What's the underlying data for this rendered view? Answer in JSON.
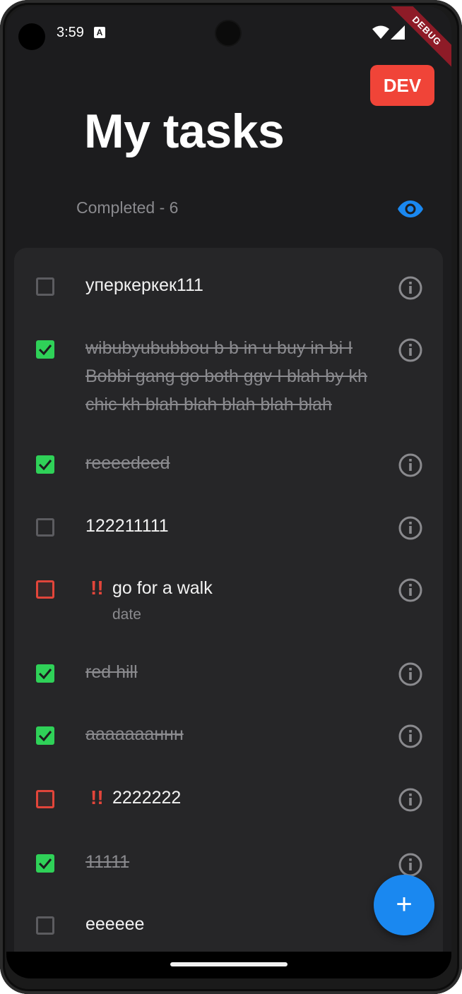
{
  "status_bar": {
    "time": "3:59",
    "notification_icon_letter": "A",
    "icons": [
      "wifi-icon",
      "signal-icon"
    ]
  },
  "debug_banner": "DEBUG",
  "env_badge": "DEV",
  "header": {
    "title": "My tasks",
    "completed_label": "Completed - 6",
    "visibility_icon": "eye-icon"
  },
  "colors": {
    "accent": "#1a88f0",
    "check": "#2fd158",
    "priority": "#e2453a",
    "badge": "#f04438"
  },
  "tasks": [
    {
      "text": "уперкеркек111",
      "done": false,
      "priority": false
    },
    {
      "text": "wibubyububbou b b in u buy in bi I Bobbi gang go both ggv I blah by kh chic kh blah blah blah blah blah",
      "done": true,
      "priority": false
    },
    {
      "text": "reeeedeed",
      "done": true,
      "priority": false
    },
    {
      "text": "122211111",
      "done": false,
      "priority": false
    },
    {
      "text": "go for a walk",
      "done": false,
      "priority": true,
      "priority_mark": "!!",
      "subtitle": "date"
    },
    {
      "text": "red hill",
      "done": true,
      "priority": false
    },
    {
      "text": "аааааааннн",
      "done": true,
      "priority": false
    },
    {
      "text": "2222222",
      "done": false,
      "priority": true,
      "priority_mark": "!!"
    },
    {
      "text": "11111",
      "done": true,
      "priority": false
    },
    {
      "text": "eeeeee",
      "done": false,
      "priority": false
    }
  ],
  "fab_label": "+"
}
